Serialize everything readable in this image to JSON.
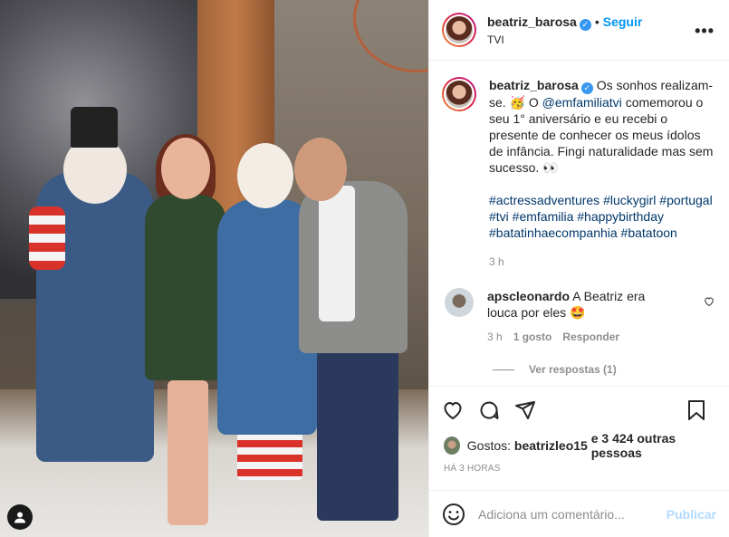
{
  "post": {
    "username": "beatriz_barosa",
    "follow_label": "Seguir",
    "location": "TVI",
    "more_label": "•••"
  },
  "caption": {
    "username": "beatriz_barosa",
    "text_1": "Os sonhos realizam-se. 🥳 O",
    "mention": "@emfamiliatvi",
    "text_2": "comemorou o seu 1° aniversário e eu recebi o presente de conhecer os meus ídolos de infância. Fingi naturalidade mas sem sucesso. 👀",
    "hashtags": "#actressadventures #luckygirl #portugal #tvi #emfamilia #happybirthday #batatinhaecompanhia #batatoon",
    "time": "3 h"
  },
  "comment": {
    "username": "apscleonardo",
    "text": "A Beatriz era louca por eles 🤩",
    "time": "3 h",
    "likes": "1 gosto",
    "reply_label": "Responder",
    "view_replies": "Ver respostas (1)"
  },
  "likes": {
    "prefix": "Gostos:",
    "user": "beatrizleo15",
    "suffix": "e 3 424 outras pessoas"
  },
  "posted_ago": "HÁ 3 HORAS",
  "add_comment": {
    "placeholder": "Adiciona um comentário...",
    "publish_label": "Publicar"
  },
  "icons": {
    "verified": "verified-icon",
    "like": "heart-icon",
    "comment": "comment-icon",
    "share": "send-icon",
    "save": "bookmark-icon",
    "emoji": "smiley-icon",
    "user_tag": "user-icon"
  },
  "colors": {
    "accent": "#0095f6",
    "link": "#00376b",
    "muted": "#8e8e8e",
    "publish_disabled": "#b3dbff"
  }
}
